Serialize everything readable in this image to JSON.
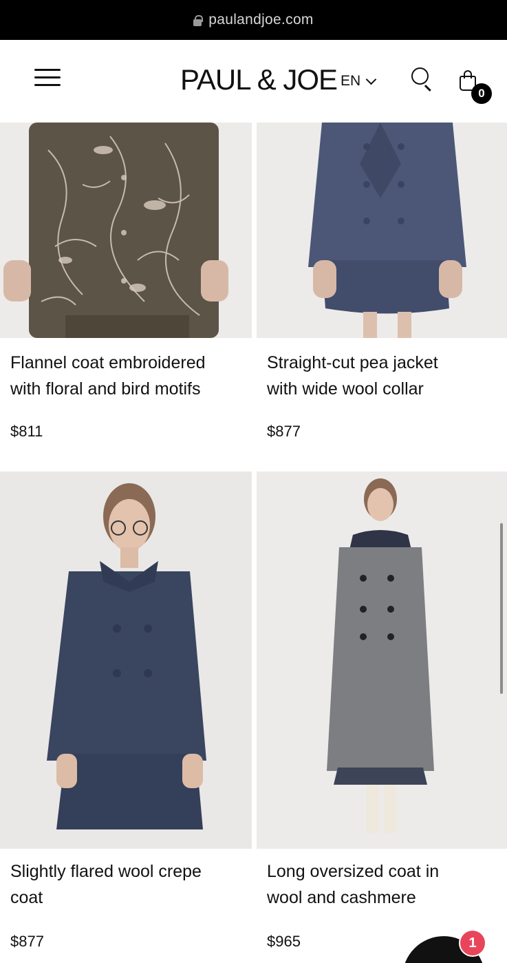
{
  "browser": {
    "url": "paulandjoe.com"
  },
  "header": {
    "logo": "PAUL & JOE",
    "language": "EN",
    "cart_count": "0"
  },
  "products": [
    {
      "name_line1": "Flannel coat embroidered",
      "name_line2": "with floral and bird motifs",
      "price": "$811",
      "garment_color": "#5c5446",
      "pattern_color": "#d9ccc0"
    },
    {
      "name_line1": "Straight-cut pea jacket",
      "name_line2": "with wide wool collar",
      "price": "$877",
      "garment_color": "#4c5778"
    },
    {
      "name_line1": "Slightly flared wool crepe",
      "name_line2": "coat",
      "price": "$877",
      "garment_color": "#3a4560"
    },
    {
      "name_line1": "Long oversized coat in",
      "name_line2": "wool and cashmere",
      "price": "$965",
      "garment_color": "#7c7e82"
    }
  ],
  "chat": {
    "unread": "1"
  }
}
